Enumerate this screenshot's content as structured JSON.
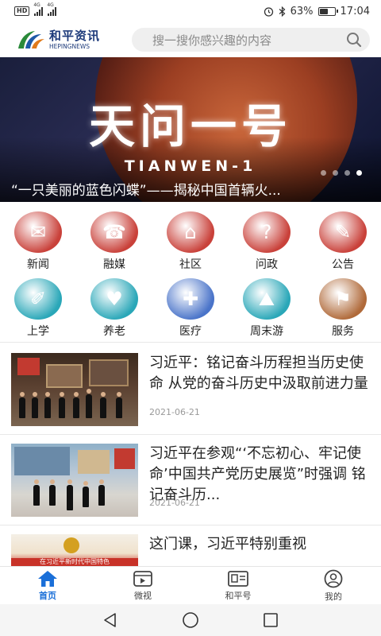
{
  "status_bar": {
    "network_badge": "HD",
    "signal1_label": "4G",
    "signal2_label": "4G",
    "battery_percent": "63%",
    "battery_level": 0.63,
    "time": "17:04",
    "icons": [
      "alarm-icon",
      "bluetooth-icon"
    ]
  },
  "header": {
    "logo_cn": "和平资讯",
    "logo_en": "HEPINGNEWS",
    "search_placeholder": "搜一搜你感兴趣的内容"
  },
  "banner": {
    "title_cn": "天问一号",
    "title_en": "TIANWEN-1",
    "caption": "“一只美丽的蓝色闪蝶”——揭秘中国首辆火...",
    "dot_count": 4,
    "active_dot": 4
  },
  "categories": [
    {
      "label": "新闻",
      "color": "#c9413a",
      "icon": "news-icon"
    },
    {
      "label": "融媒",
      "color": "#c9413a",
      "icon": "media-icon"
    },
    {
      "label": "社区",
      "color": "#c9413a",
      "icon": "community-icon"
    },
    {
      "label": "问政",
      "color": "#c9413a",
      "icon": "inquiry-icon"
    },
    {
      "label": "公告",
      "color": "#c9413a",
      "icon": "notice-icon"
    },
    {
      "label": "上学",
      "color": "#2aa7b8",
      "icon": "school-icon"
    },
    {
      "label": "养老",
      "color": "#2aa7b8",
      "icon": "elderly-icon"
    },
    {
      "label": "医疗",
      "color": "#4a74c9",
      "icon": "medical-icon"
    },
    {
      "label": "周末游",
      "color": "#2aa7b8",
      "icon": "travel-icon"
    },
    {
      "label": "服务",
      "color": "#b06a3a",
      "icon": "service-icon"
    }
  ],
  "news": [
    {
      "title": "习近平：铭记奋斗历程担当历史使命 从党的奋斗历史中汲取前进力量",
      "date": "2021-06-21"
    },
    {
      "title": "习近平在参观“‘不忘初心、牢记使命’中国共产党历史展览”时强调 铭记奋斗历...",
      "date": "2021-06-21"
    },
    {
      "title": "这门课，习近平特别重视",
      "date": ""
    }
  ],
  "news_thumb_text": "在习近平新时代中国特色",
  "bottom_nav": [
    {
      "label": "首页",
      "icon": "home-icon",
      "active": true
    },
    {
      "label": "微视",
      "icon": "video-icon",
      "active": false
    },
    {
      "label": "和平号",
      "icon": "account-icon",
      "active": false
    },
    {
      "label": "我的",
      "icon": "profile-icon",
      "active": false
    }
  ],
  "colors": {
    "accent": "#1a6fd8",
    "logo": "#1d3a7a"
  }
}
